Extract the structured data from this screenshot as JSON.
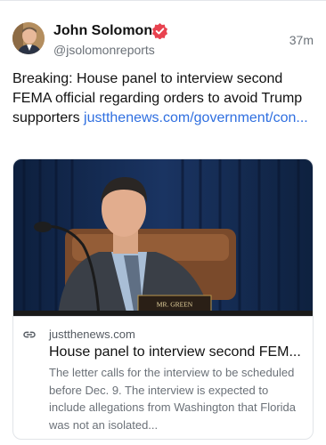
{
  "post": {
    "author_name": "John Solomon",
    "author_handle": "@jsolomonreports",
    "time": "37m",
    "text": "Breaking: House panel to interview second FEMA official regarding orders to avoid Trump supporters ",
    "link_text": "justthenews.com/government/con..."
  },
  "link_card": {
    "image_caption_sign": "MR. GREEN",
    "domain": "justthenews.com",
    "title": "House panel to interview second FEM...",
    "description": "The letter calls for the interview to be scheduled before Dec. 9. The interview is expected to include allegations from Washington that Florida was not an isolated..."
  },
  "colors": {
    "link": "#2f6fe0",
    "verified_badge": "#e8424f",
    "secondary_text": "#6b7178"
  }
}
